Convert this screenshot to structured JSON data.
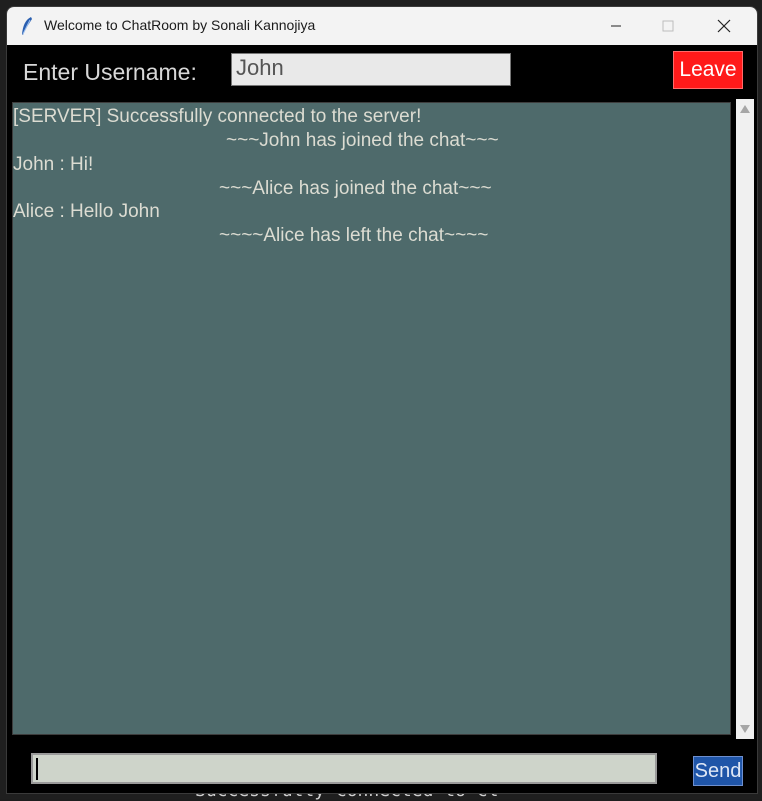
{
  "window": {
    "title": "Welcome to ChatRoom by Sonali Kannojiya"
  },
  "header": {
    "username_label": "Enter Username:",
    "username_value": "John",
    "leave_label": "Leave"
  },
  "chat": {
    "messages": [
      "[SERVER] Successfully connected to the server!",
      "~~~John has joined the chat~~~",
      "John : Hi!",
      "~~~Alice has joined the chat~~~",
      "Alice : Hello John",
      "~~~~Alice has left the chat~~~~"
    ]
  },
  "footer": {
    "message_value": "",
    "send_label": "Send"
  },
  "background": {
    "terminal_text": "Successfully connected to cl"
  },
  "colors": {
    "chat_bg": "#4e6a6b",
    "leave_bg": "#ff1a1a",
    "send_bg": "#1f55a8"
  }
}
